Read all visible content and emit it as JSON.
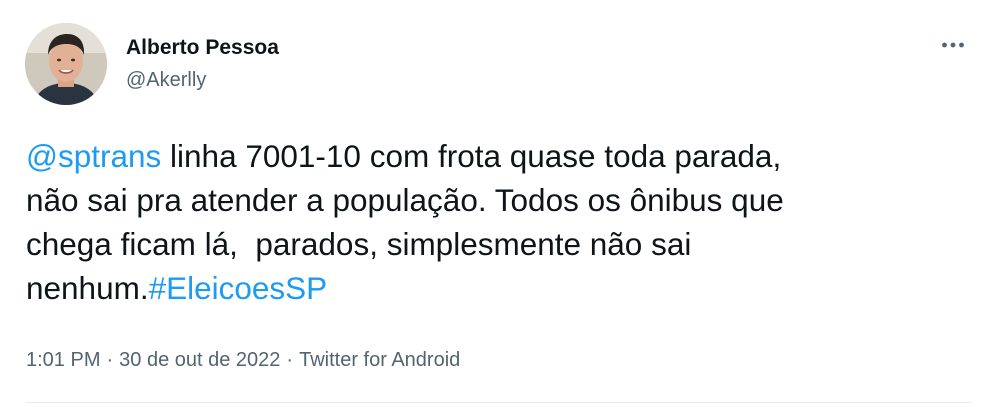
{
  "author": {
    "display_name": "Alberto Pessoa",
    "handle": "@Akerlly",
    "avatar": "profile-photo"
  },
  "more_icon": "more-horizontal-icon",
  "tweet": {
    "line1_mention": "@sptrans",
    "line1_rest": " linha 7001-10 com frota quase toda parada,",
    "line2": "não sai pra atender a população. Todos os ônibus que",
    "line3": "chega ficam lá,  parados, simplesmente não sai",
    "line4_prefix": "nenhum.",
    "line4_hashtag": "#EleicoesSP"
  },
  "meta": {
    "time": "1:01 PM",
    "separator": "·",
    "date": "30 de out de 2022",
    "source": "Twitter for Android"
  },
  "colors": {
    "link": "#1d9bf0",
    "text": "#0f1419",
    "secondary": "#536471"
  }
}
